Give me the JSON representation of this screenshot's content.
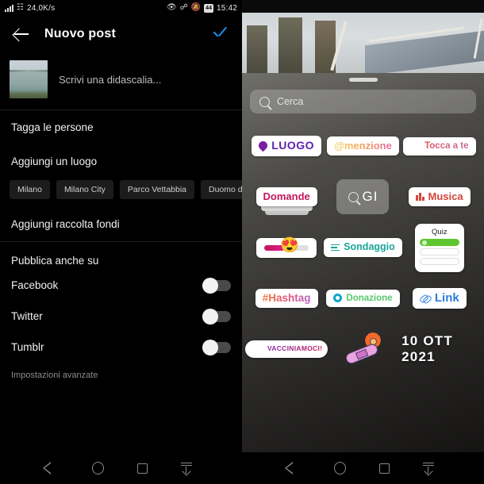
{
  "status_bar": {
    "network_speed": "24,0K/s",
    "battery_level": "44",
    "time": "15:42",
    "icons": [
      "signal-bars-icon",
      "wifi-icon",
      "eye-icon",
      "bluetooth-icon",
      "mute-bell-icon",
      "battery-icon"
    ]
  },
  "left_panel": {
    "app_bar": {
      "back_label": "",
      "title": "Nuovo post",
      "confirm_label": ""
    },
    "caption": {
      "placeholder": "Scrivi una didascalia...",
      "thumbnail_alt": "lake-photo-thumbnail"
    },
    "rows": [
      {
        "label": "Tagga le persone"
      },
      {
        "label": "Aggiungi un luogo"
      }
    ],
    "location_chips": [
      "Milano",
      "Milano City",
      "Parco Vettabbia",
      "Duomo di M"
    ],
    "fundraiser_row": {
      "label": "Aggiungi raccolta fondi"
    },
    "share_section": {
      "title": "Pubblica anche su",
      "toggles": [
        {
          "label": "Facebook",
          "state": "off"
        },
        {
          "label": "Twitter",
          "state": "off"
        },
        {
          "label": "Tumblr",
          "state": "off"
        }
      ]
    },
    "advanced_settings": "Impostazioni avanzate"
  },
  "right_panel": {
    "search": {
      "placeholder": "Cerca",
      "icon": "search-icon"
    },
    "grabber": "drag-handle",
    "sticker_rows": [
      [
        {
          "id": "luogo",
          "label": "LUOGO",
          "icon": "location-pin-icon",
          "color": "#5b1fb0"
        },
        {
          "id": "menzione",
          "label": "@menzione",
          "color": "#f0a05a"
        },
        {
          "id": "tocca-a-te",
          "label": "Tocca a te",
          "icon": "camera-icon",
          "color": "#d4657f"
        }
      ],
      [
        {
          "id": "domande",
          "label": "Domande",
          "color": "#c2185b"
        },
        {
          "id": "gif",
          "label": "GI",
          "icon": "search-icon"
        },
        {
          "id": "musica",
          "label": "Musica",
          "icon": "equalizer-icon",
          "color": "#d2443c"
        }
      ],
      [
        {
          "id": "emoji-slider",
          "label": "",
          "emoji": "😍"
        },
        {
          "id": "sondaggio",
          "label": "Sondaggio",
          "color": "#1aa59a"
        },
        {
          "id": "quiz",
          "label": "Quiz"
        }
      ],
      [
        {
          "id": "hashtag",
          "label": "#Hashtag",
          "color": "#e8527a"
        },
        {
          "id": "donazione",
          "label": "Donazione",
          "color": "#57c76b"
        },
        {
          "id": "link",
          "label": "Link",
          "icon": "chain-icon",
          "color": "#2a7de1"
        }
      ],
      [
        {
          "id": "vacciniamoci",
          "label": "VACCINIAMOCI!",
          "icon": "heart-badge-icon",
          "color": "#9c27b0"
        },
        {
          "id": "bandage",
          "label": "",
          "icon": "bandage-flower-icon"
        },
        {
          "id": "date",
          "label": "10 OTT 2021"
        }
      ]
    ]
  },
  "nav_bar": {
    "items": [
      "back-icon",
      "home-icon",
      "recents-icon",
      "download-icon"
    ]
  }
}
